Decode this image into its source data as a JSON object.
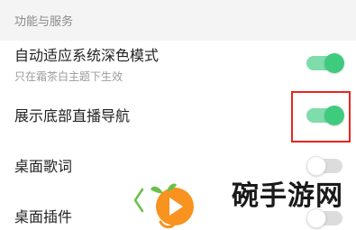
{
  "section": {
    "title": "功能与服务"
  },
  "rows": [
    {
      "label": "自动适应系统深色模式",
      "subtitle": "只在霜茶白主题下生效",
      "toggle": "on"
    },
    {
      "label": "展示底部直播导航",
      "toggle": "on"
    },
    {
      "label": "桌面歌词",
      "toggle": "off"
    },
    {
      "label": "桌面插件",
      "toggle": "off"
    }
  ],
  "watermark": {
    "text": "碗手游网",
    "logo_icon": "orange-play-logo-icon"
  },
  "colors": {
    "toggle_on_knob": "#3fcb7e",
    "toggle_on_track": "#7fdcab",
    "toggle_off_track": "#dcdcdc",
    "highlight_border": "#e8241d",
    "logo_orange": "#f7931e",
    "logo_green": "#6cc04a"
  }
}
